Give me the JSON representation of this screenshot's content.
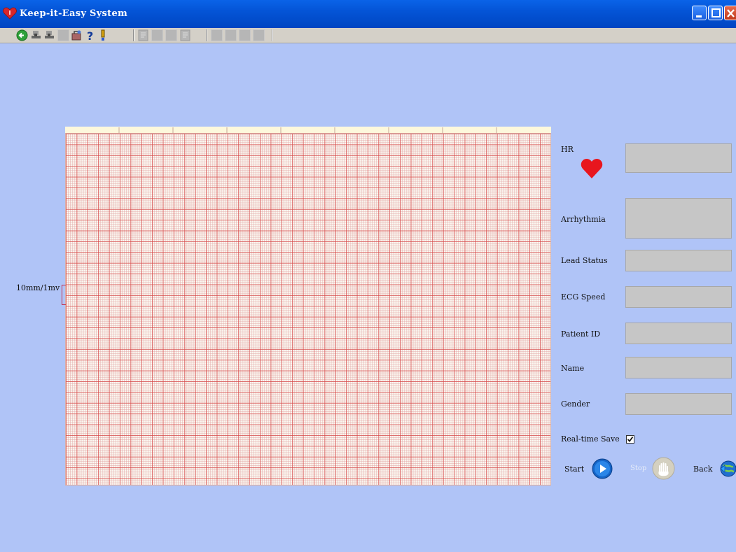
{
  "window": {
    "title": "Keep-it-Easy System",
    "buttons": [
      "minimize",
      "maximize",
      "close"
    ]
  },
  "toolbar": {
    "icons": [
      "back-arrow-icon",
      "stamp-icon",
      "stamp-icon",
      "disabled",
      "tools-icon",
      "help-icon",
      "exclamation-icon",
      "document-icon",
      "disabled",
      "disabled",
      "document-icon",
      "disabled",
      "disabled",
      "disabled",
      "disabled"
    ]
  },
  "ecg": {
    "scale_label": "10mm/1mv"
  },
  "panel": {
    "hr_label": "HR",
    "arrhythmia_label": "Arrhythmia",
    "lead_status_label": "Lead Status",
    "ecg_speed_label": "ECG Speed",
    "patient_id_label": "Patient ID",
    "name_label": "Name",
    "gender_label": "Gender",
    "realtime_save_label": "Real-time Save",
    "realtime_save_checked": true,
    "hr_value": "",
    "arrhythmia_value": "",
    "lead_status_value": "",
    "ecg_speed_value": "",
    "patient_id_value": "",
    "name_value": "",
    "gender_value": ""
  },
  "actions": {
    "start_label": "Start",
    "stop_label": "Stop",
    "back_label": "Back"
  },
  "colors": {
    "background": "#b0c4f7",
    "titlebar": "#0454d6",
    "grid_major": "#d74646",
    "grid_minor": "#e1a0a0",
    "heart": "#e8161e",
    "start_button": "#1565c8"
  }
}
